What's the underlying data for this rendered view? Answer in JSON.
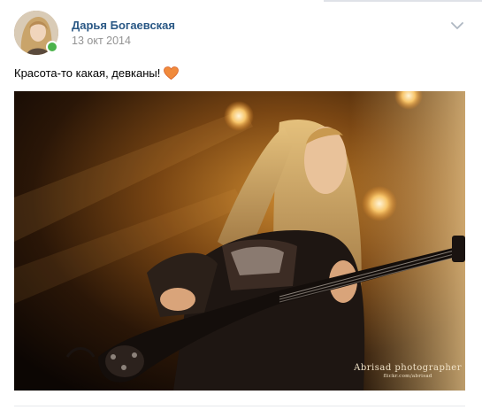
{
  "post": {
    "author": "Дарья Богаевская",
    "date": "13 окт 2014",
    "text": "Красота-то какая, девканы!",
    "emoji_icon": "orange-heart-icon",
    "online_status_color": "#4bb34b",
    "author_color": "#2a5885",
    "menu_icon": "chevron-down-icon"
  },
  "photo": {
    "watermark_line1": "Abrisad photographer",
    "watermark_line2": "flickr.com/abrisad"
  }
}
